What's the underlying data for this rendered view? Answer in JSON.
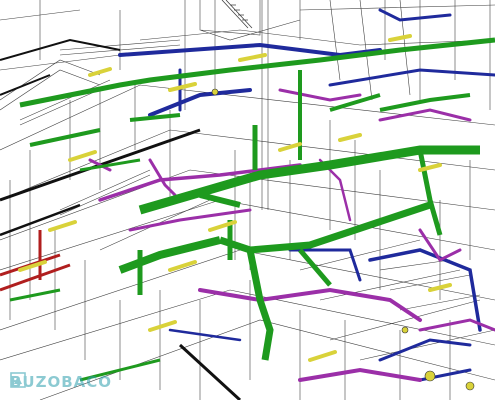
{
  "image": {
    "kind": "3D BIM MEP coordination model render (wireframe building with colour-coded ducts and pipes)",
    "colors": {
      "background": "#ffffff",
      "wireframe": "#000000",
      "duct_main": "#1e9a1e",
      "pipe_purple": "#9b2fa8",
      "pipe_blue": "#1f2a9c",
      "pipe_red": "#b01e1e",
      "light_fixture_yellow": "#d9d23a",
      "cable_tray_black": "#111111",
      "watermark": "#2f9fae"
    }
  },
  "watermark": {
    "text": "BUZOBACO",
    "icon": "logo-icon"
  }
}
